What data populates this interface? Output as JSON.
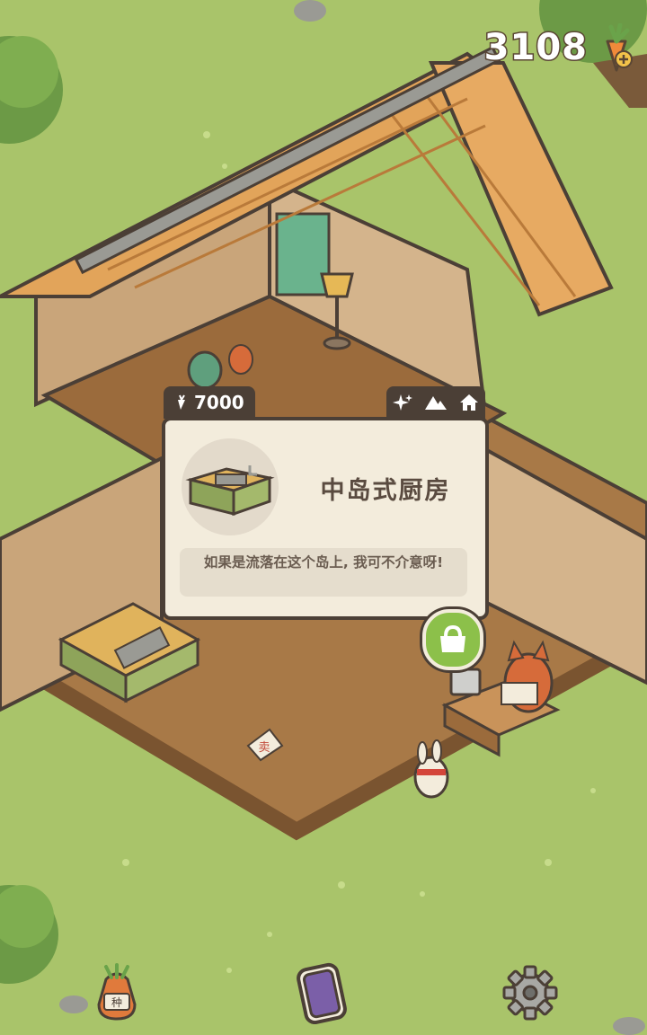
{
  "hud": {
    "carrot_count": "3108",
    "carrot_icon": "carrot-plus-icon"
  },
  "item_popup": {
    "price": "7000",
    "price_icon": "carrot-icon",
    "tab_icons": [
      "sparkle-icon",
      "mountains-icon",
      "house-icon"
    ],
    "item_name": "中岛式厨房",
    "description": "如果是流落在这个岛上, 我可不介意呀!",
    "thumbnail": "island-kitchen-icon"
  },
  "scene_objects": {
    "sign_label": "卖"
  },
  "bottom_bar": {
    "items": [
      "seed-bag-icon",
      "phone-icon",
      "settings-gear-icon"
    ],
    "seed_bag_label": "种"
  },
  "colors": {
    "grass": "#a9c46a",
    "panel_dark": "#4b3f36",
    "panel_light": "#f3ecdc",
    "accent_green": "#8cc04a"
  }
}
